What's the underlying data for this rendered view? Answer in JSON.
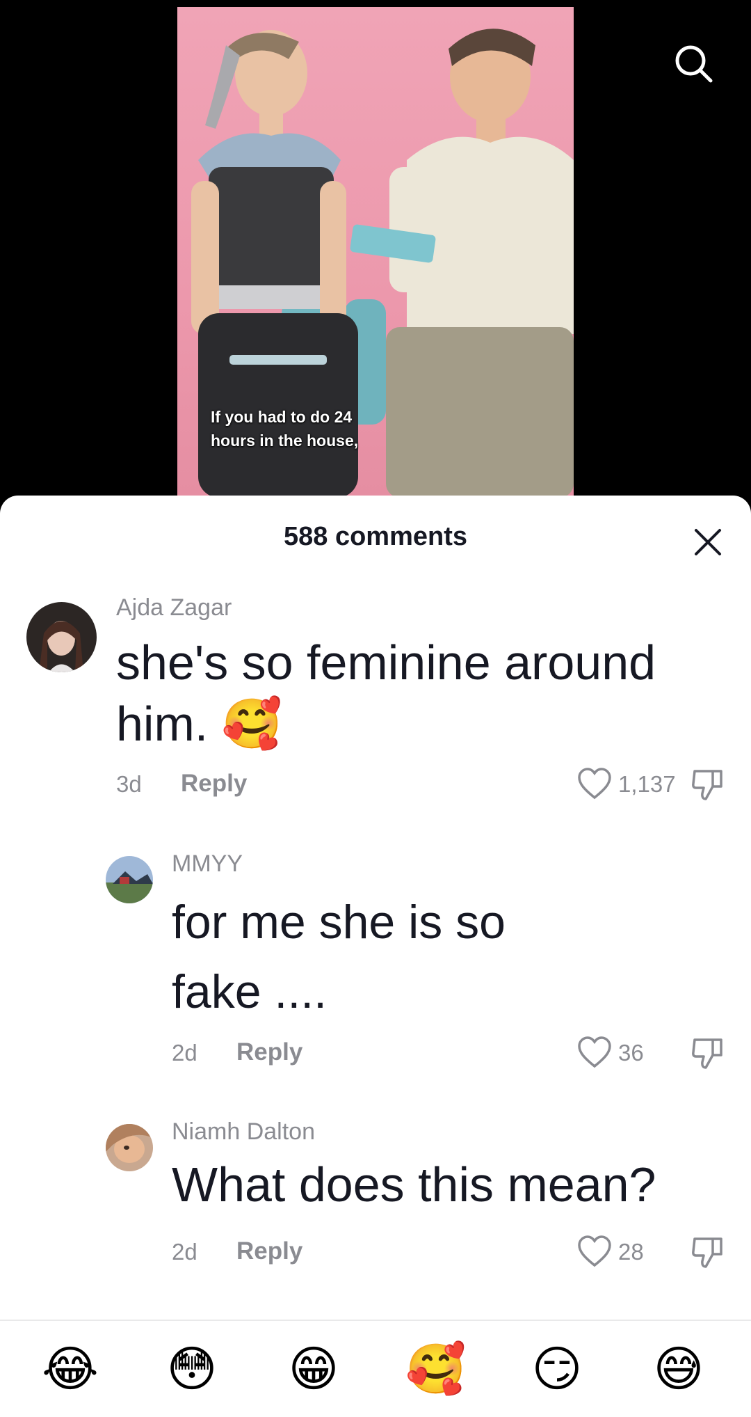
{
  "video": {
    "caption_line1": "If you had to do 24",
    "caption_line2": "hours in the house,"
  },
  "icons": {
    "search": "search-icon",
    "close": "close-icon",
    "like": "heart-outline-icon",
    "dislike": "thumbs-down-icon"
  },
  "sheet": {
    "title": "588 comments"
  },
  "comments": [
    {
      "username": "Ajda Zagar",
      "text_line1": "she's so feminine around",
      "text_line2": "him.",
      "emoji": "🥰",
      "time": "3d",
      "reply_label": "Reply",
      "likes": "1,137"
    },
    {
      "username": "MMYY",
      "text_line1": "for me she is so",
      "text_line2": "fake ....",
      "time": "2d",
      "reply_label": "Reply",
      "likes": "36"
    },
    {
      "username": "Niamh Dalton",
      "text_line1": "What does this mean?",
      "time": "2d",
      "reply_label": "Reply",
      "likes": "28"
    }
  ],
  "emoji_bar": [
    "😂",
    "😳",
    "😁",
    "🥰",
    "😏",
    "😅"
  ],
  "colors": {
    "video_bg": "#ec98ac",
    "text_primary": "#161823",
    "text_secondary": "#8a8b91"
  }
}
